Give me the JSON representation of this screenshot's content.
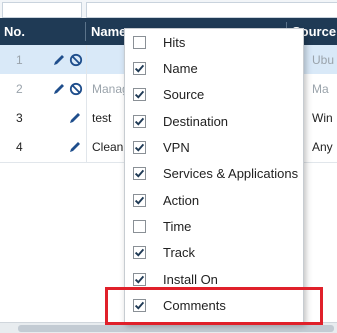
{
  "grid": {
    "headers": {
      "no": "No.",
      "name": "Name",
      "source": "Source"
    },
    "rows": [
      {
        "no": "1",
        "name": "",
        "source": "Ubu",
        "selected": true,
        "muted": true
      },
      {
        "no": "2",
        "name": "Manag",
        "source": "Ma",
        "selected": false,
        "muted": true
      },
      {
        "no": "3",
        "name": "test",
        "source": "Win",
        "selected": false,
        "muted": false
      },
      {
        "no": "4",
        "name": "Cleanu",
        "source": "Any",
        "selected": false,
        "muted": false
      }
    ]
  },
  "column_menu": {
    "items": [
      {
        "label": "Hits",
        "checked": false
      },
      {
        "label": "Name",
        "checked": true
      },
      {
        "label": "Source",
        "checked": true
      },
      {
        "label": "Destination",
        "checked": true
      },
      {
        "label": "VPN",
        "checked": true
      },
      {
        "label": "Services & Applications",
        "checked": true
      },
      {
        "label": "Action",
        "checked": true
      },
      {
        "label": "Time",
        "checked": false
      },
      {
        "label": "Track",
        "checked": true
      },
      {
        "label": "Install On",
        "checked": true
      },
      {
        "label": "Comments",
        "checked": true
      }
    ]
  },
  "colors": {
    "header_bg": "#1f3a55",
    "selected_row_bg": "#d9e9f8",
    "icon_blue": "#1f4e8c",
    "highlight_red": "#e0202a"
  },
  "icons": {
    "edit": "pencil-icon",
    "disabled": "disable-icon",
    "checkbox": "checkmark-icon"
  }
}
